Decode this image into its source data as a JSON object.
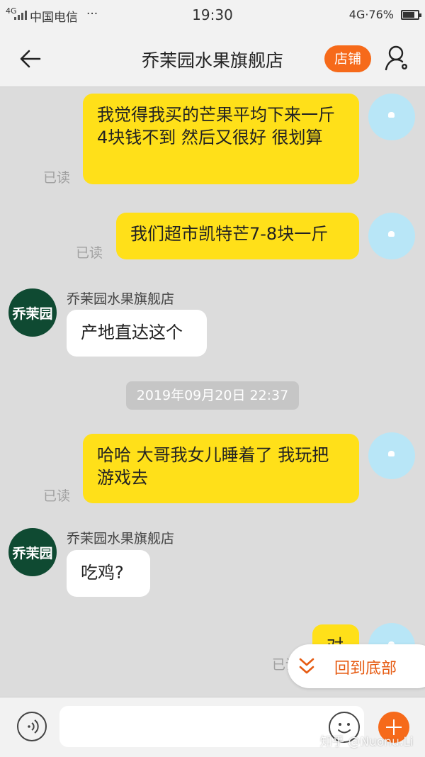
{
  "status_bar": {
    "signal_label": "4G",
    "carrier": "中国电信",
    "more": "···",
    "time": "19:30",
    "network": "4G·76%"
  },
  "header": {
    "title": "乔茉园水果旗舰店",
    "shop_button": "店铺",
    "icons": {
      "back": "back-arrow-icon",
      "profile": "user-settings-icon"
    }
  },
  "messages": [
    {
      "from": "me",
      "text": "我觉得我买的芒果平均下来一斤4块钱不到 然后又很好 很划算",
      "status": "已读"
    },
    {
      "from": "me",
      "text": "我们超市凯特芒7-8块一斤",
      "status": "已读"
    },
    {
      "from": "shop",
      "sender": "乔茉园水果旗舰店",
      "text": "产地直达这个"
    },
    {
      "type": "time",
      "text": "2019年09月20日 22:37"
    },
    {
      "from": "me",
      "text": "哈哈 大哥我女儿睡着了 我玩把游戏去",
      "status": "已读"
    },
    {
      "from": "shop",
      "sender": "乔茉园水果旗舰店",
      "text": "吃鸡?"
    },
    {
      "from": "me",
      "text": "对",
      "status": "已读"
    }
  ],
  "shop_avatar_text": "乔茉园",
  "jump_to_bottom": "回到底部",
  "input_bar": {
    "placeholder": "",
    "icons": [
      "voice-icon",
      "emoji-icon",
      "plus-icon"
    ]
  },
  "watermark": "知乎 @Nuonu.Li",
  "colors": {
    "accent": "#f66a1a",
    "self_bubble": "#ffe019",
    "shop_avatar": "#0f4a32"
  }
}
